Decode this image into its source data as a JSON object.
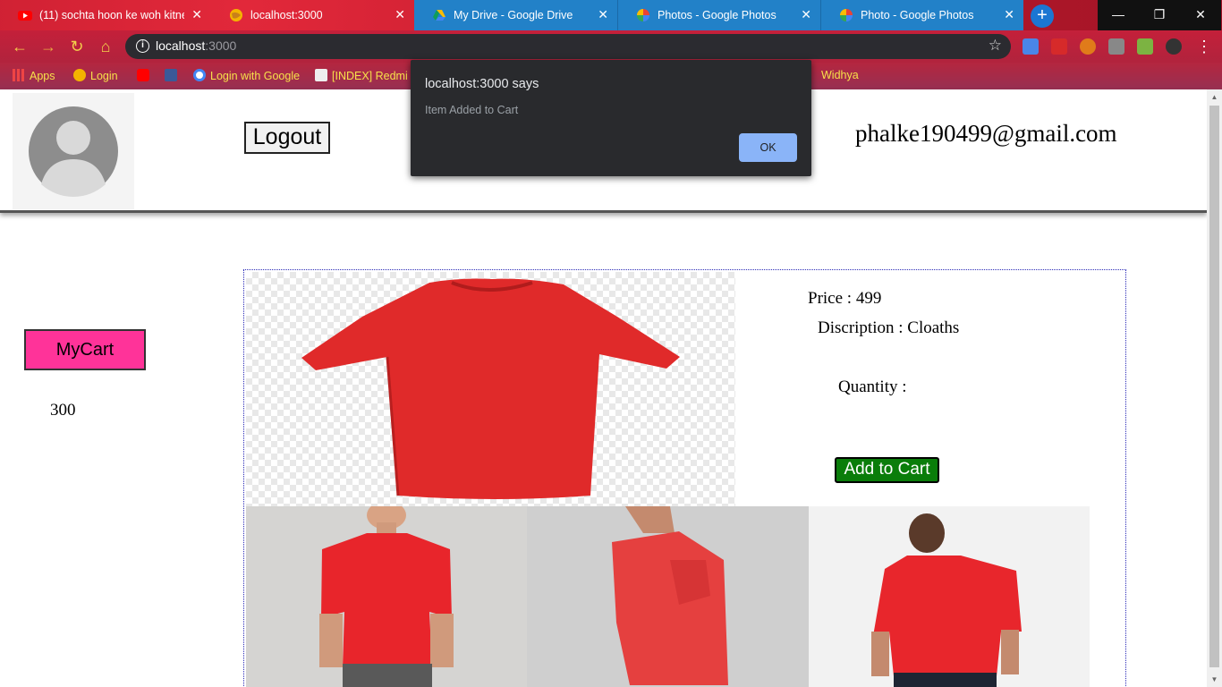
{
  "browser": {
    "tabs": [
      {
        "title": "(11) sochta hoon ke woh kitne",
        "icon": "youtube-icon"
      },
      {
        "title": "localhost:3000",
        "icon": "globe-icon"
      },
      {
        "title": "My Drive - Google Drive",
        "icon": "google-drive-icon"
      },
      {
        "title": "Photos - Google Photos",
        "icon": "google-photos-icon"
      },
      {
        "title": "Photo - Google Photos",
        "icon": "google-photos-icon"
      }
    ],
    "address": {
      "host": "localhost",
      "port": ":3000"
    },
    "bookmarks": [
      {
        "label": "Apps",
        "icon": "apps-grid-icon"
      },
      {
        "label": "Login",
        "icon": "globe-icon"
      },
      {
        "label": "",
        "icon": "youtube-icon"
      },
      {
        "label": "",
        "icon": "facebook-icon"
      },
      {
        "label": "Login with Google",
        "icon": "google-icon"
      },
      {
        "label": "[INDEX] Redmi",
        "icon": "xda-icon"
      },
      {
        "label": "Widhya",
        "icon": "globe-icon"
      }
    ]
  },
  "header": {
    "logout_label": "Logout",
    "email": "phalke190499@gmail.com"
  },
  "sidebar": {
    "cart_label": "MyCart",
    "cart_count": "300"
  },
  "product": {
    "price_text": "Price : 499",
    "description_text": "Discription : Cloaths",
    "quantity_label": "Quantity :",
    "add_label": "Add to Cart"
  },
  "dialog": {
    "title": "localhost:3000 says",
    "message": "Item Added to Cart",
    "ok_label": "OK"
  },
  "colors": {
    "cart_button": "#ff3399",
    "add_button": "#0a7d0a",
    "dialog_bg": "#292a2d",
    "dialog_ok": "#8ab4f8",
    "shirt_red": "#e02a2a"
  }
}
